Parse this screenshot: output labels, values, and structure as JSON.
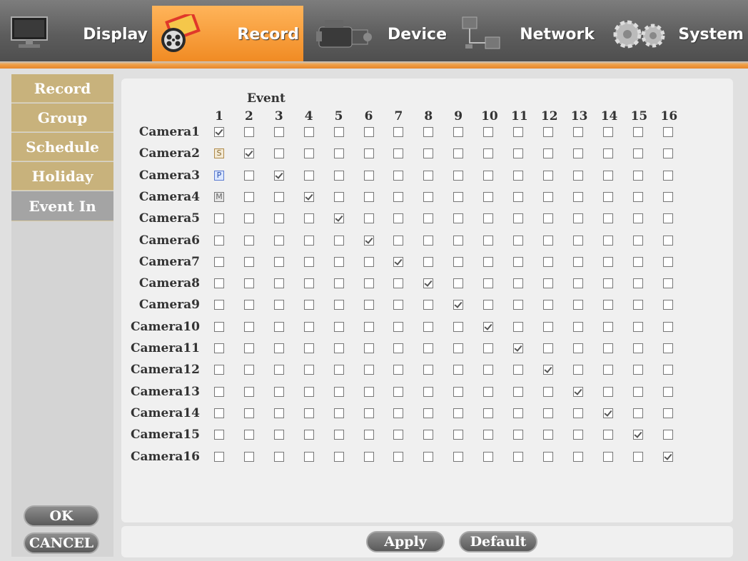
{
  "top_tabs": [
    {
      "label": "Display",
      "icon": "monitor-icon"
    },
    {
      "label": "Record",
      "icon": "film-reel-icon",
      "active": true
    },
    {
      "label": "Device",
      "icon": "camcorder-icon"
    },
    {
      "label": "Network",
      "icon": "network-icon"
    },
    {
      "label": "System",
      "icon": "gear-icon"
    }
  ],
  "sidebar": {
    "items": [
      "Record",
      "Group",
      "Schedule",
      "Holiday",
      "Event In"
    ],
    "active_index": 4
  },
  "grid": {
    "header": "Event",
    "columns": [
      "1",
      "2",
      "3",
      "4",
      "5",
      "6",
      "7",
      "8",
      "9",
      "10",
      "11",
      "12",
      "13",
      "14",
      "15",
      "16"
    ],
    "rows": [
      {
        "camera": "Camera1",
        "first": "check"
      },
      {
        "camera": "Camera2",
        "first": "S"
      },
      {
        "camera": "Camera3",
        "first": "P"
      },
      {
        "camera": "Camera4",
        "first": "M"
      },
      {
        "camera": "Camera5"
      },
      {
        "camera": "Camera6"
      },
      {
        "camera": "Camera7"
      },
      {
        "camera": "Camera8"
      },
      {
        "camera": "Camera9"
      },
      {
        "camera": "Camera10"
      },
      {
        "camera": "Camera11"
      },
      {
        "camera": "Camera12"
      },
      {
        "camera": "Camera13"
      },
      {
        "camera": "Camera14"
      },
      {
        "camera": "Camera15"
      },
      {
        "camera": "Camera16"
      }
    ]
  },
  "buttons": {
    "ok": "OK",
    "cancel": "CANCEL",
    "apply": "Apply",
    "default": "Default"
  },
  "colors": {
    "active_tab": "#f08a22",
    "sidebar_item": "#c8b27c",
    "sidebar_active": "#a4a4a4"
  }
}
